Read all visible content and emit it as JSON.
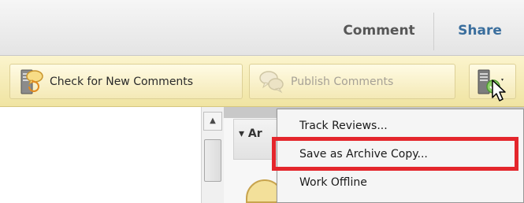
{
  "nav": {
    "comment": "Comment",
    "share": "Share"
  },
  "toolbar": {
    "check_label": "Check for New Comments",
    "publish_label": "Publish Comments"
  },
  "panel": {
    "header_fragment": "▾ Ar"
  },
  "menu": {
    "items": [
      {
        "label": "Track Reviews..."
      },
      {
        "label": "Save as Archive Copy..."
      },
      {
        "label": "Work Offline"
      }
    ]
  },
  "icons": {
    "check": "server-comment-icon",
    "publish": "comments-icon",
    "review": "server-check-icon",
    "cursor": "mouse-pointer-icon"
  },
  "colors": {
    "toolbar": "#f0e4a2",
    "share": "#3a6e9d",
    "highlight": "#e4262c"
  }
}
